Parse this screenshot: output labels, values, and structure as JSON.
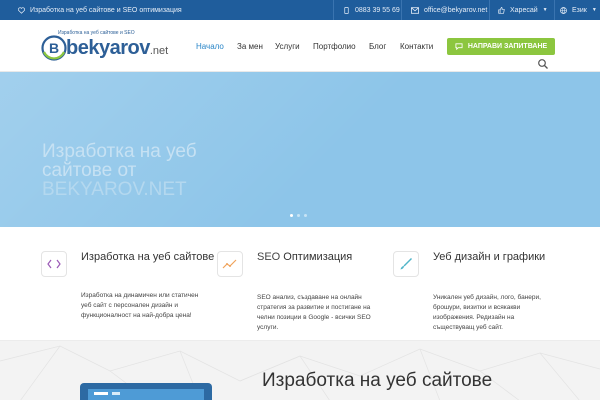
{
  "topbar": {
    "tagline": "Изработка на уеб сайтове и SEO оптимизация",
    "phone": "0883 39 55 69",
    "email": "office@bekyarov.net",
    "currency": "Харесай",
    "language": "Език"
  },
  "logo": {
    "tagline": "Изработка на уеб сайтове и SEO",
    "name": "bekyarov",
    "suffix": ".net",
    "letter": "B"
  },
  "nav": {
    "items": [
      "Начало",
      "За мен",
      "Услуги",
      "Портфолио",
      "Блог",
      "Контакти"
    ],
    "active_index": 0,
    "cta_label": "НАПРАВИ ЗАПИТВАНЕ"
  },
  "hero": {
    "title_line1": "Изработка на уеб",
    "title_line2": "сайтове",
    "title_from": "от",
    "title_brand": "BEKYAROV.NET",
    "slides": 3,
    "active_slide": 0
  },
  "services": [
    {
      "icon": "code-icon",
      "title": "Изработка на уеб сайтове",
      "text": "Изработка на динамичен или статичен уеб сайт с персонален дизайн и функционалност на най-добра цена!"
    },
    {
      "icon": "chart-icon",
      "title_prefix": "SEO",
      "title": "Оптимизация",
      "text": "SEO анализ, създаване на онлайн стратегия за развитие и постигане на челни позиции в Google - всички SEO услуги."
    },
    {
      "icon": "brush-icon",
      "title": "Уеб дизайн и графики",
      "text": "Уникален уеб дизайн, лого, банери, брошури, визитки и всякакви изображения. Редизайн на съществуващ уеб сайт."
    }
  ],
  "lower": {
    "title": "Изработка на уеб сайтове"
  },
  "colors": {
    "topbar": "#1f5d9c",
    "accent": "#2a86c8",
    "cta": "#8cc63f",
    "hero": "#8dc5e9"
  }
}
